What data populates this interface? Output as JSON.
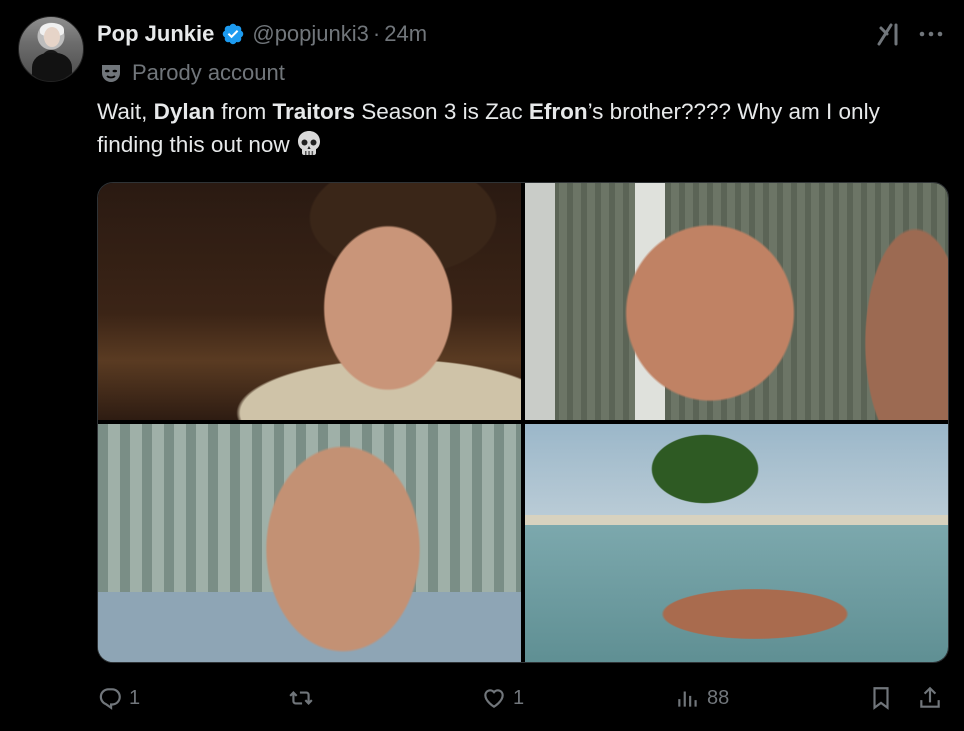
{
  "author": {
    "name": "Pop Junkie",
    "handle": "@popjunki3",
    "separator": "·",
    "time": "24m",
    "label": "Parody account",
    "verified": true
  },
  "tweet": {
    "parts": [
      "Wait, ",
      "Dylan",
      " from ",
      "Traitors",
      " Season 3 is Zac ",
      "Efron",
      "’s brother???? Why am I only finding this out now"
    ],
    "emoji": "skull"
  },
  "media": {
    "count": 4,
    "items": [
      "photo-1",
      "photo-2",
      "photo-3",
      "photo-4"
    ]
  },
  "actions": {
    "replies": "1",
    "reposts": "",
    "likes": "1",
    "views": "88"
  },
  "colors": {
    "background": "#000000",
    "text": "#e7e9ea",
    "muted": "#71767b",
    "verified": "#1d9bf0",
    "border": "#2f3336"
  },
  "icons": [
    "verified-badge-icon",
    "parody-mask-icon",
    "grok-icon",
    "more-icon",
    "skull-icon",
    "reply-icon",
    "repost-icon",
    "like-icon",
    "views-icon",
    "bookmark-icon",
    "share-icon"
  ]
}
